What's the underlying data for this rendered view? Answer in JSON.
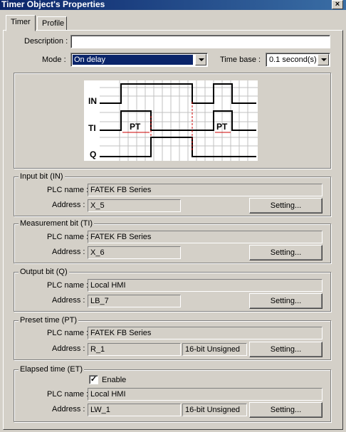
{
  "window": {
    "title": "Timer Object's Properties",
    "close_glyph": "×"
  },
  "tabs": [
    {
      "label": "Timer",
      "active": true
    },
    {
      "label": "Profile",
      "active": false
    }
  ],
  "form": {
    "description_label": "Description :",
    "description_value": "",
    "mode_label": "Mode :",
    "mode_value": "On delay",
    "timebase_label": "Time base :",
    "timebase_value": "0.1 second(s)"
  },
  "diagram": {
    "in_label": "IN",
    "ti_label": "TI",
    "q_label": "Q",
    "pt_label": "PT"
  },
  "groups": {
    "input": {
      "title": "Input bit (IN)",
      "plc_label": "PLC name :",
      "plc_value": "FATEK FB Series",
      "address_label": "Address :",
      "address_value": "X_5",
      "setting": "Setting..."
    },
    "measurement": {
      "title": "Measurement bit (TI)",
      "plc_label": "PLC name :",
      "plc_value": "FATEK FB Series",
      "address_label": "Address :",
      "address_value": "X_6",
      "setting": "Setting..."
    },
    "output": {
      "title": "Output bit (Q)",
      "plc_label": "PLC name :",
      "plc_value": "Local HMI",
      "address_label": "Address :",
      "address_value": "LB_7",
      "setting": "Setting..."
    },
    "preset": {
      "title": "Preset time (PT)",
      "plc_label": "PLC name :",
      "plc_value": "FATEK FB Series",
      "address_label": "Address :",
      "address_value": "R_1",
      "type_value": "16-bit Unsigned",
      "setting": "Setting..."
    },
    "elapsed": {
      "title": "Elapsed time (ET)",
      "enable_label": "Enable",
      "enable_checked": true,
      "plc_label": "PLC name :",
      "plc_value": "Local HMI",
      "address_label": "Address :",
      "address_value": "LW_1",
      "type_value": "16-bit Unsigned",
      "setting": "Setting..."
    }
  },
  "colors": {
    "face": "#d4d0c8",
    "title_start": "#0a246a",
    "title_end": "#3a6ea5",
    "pulse_marker": "#cc0000"
  }
}
